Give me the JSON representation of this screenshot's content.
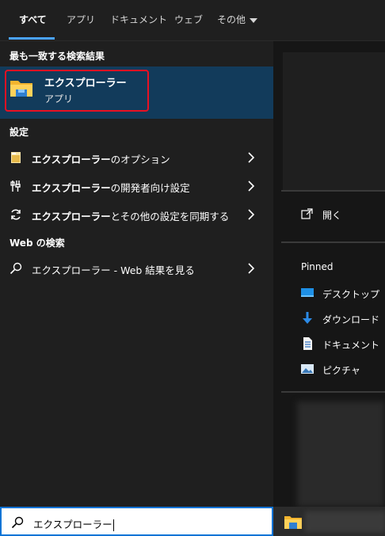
{
  "tabs": {
    "all": "すべて",
    "apps": "アプリ",
    "documents": "ドキュメント",
    "web": "ウェブ",
    "more": "その他"
  },
  "best_match": {
    "section": "最も一致する検索結果",
    "title": "エクスプローラー",
    "subtitle": "アプリ"
  },
  "settings": {
    "section": "設定",
    "items": [
      {
        "bold": "エクスプローラー",
        "rest": "のオプション",
        "icon": "options-icon"
      },
      {
        "bold": "エクスプローラー",
        "rest": "の開発者向け設定",
        "icon": "developer-tools-icon"
      },
      {
        "bold": "エクスプローラー",
        "rest": "とその他の設定を同期する",
        "icon": "sync-icon"
      }
    ]
  },
  "web_search": {
    "section": "Web の検索",
    "label": "エクスプローラー - Web 結果を見る",
    "icon": "search-icon"
  },
  "right_panel": {
    "open_label": "開く",
    "pinned_title": "Pinned",
    "pinned": [
      {
        "label": "デスクトップ",
        "icon": "desktop-icon"
      },
      {
        "label": "ダウンロード",
        "icon": "download-icon"
      },
      {
        "label": "ドキュメント",
        "icon": "document-icon"
      },
      {
        "label": "ピクチャ",
        "icon": "pictures-icon"
      }
    ]
  },
  "search_box": {
    "value": "エクスプローラー"
  },
  "colors": {
    "accent": "#4aa3ff",
    "highlight": "#123b5b",
    "outline_red": "#e81123"
  }
}
